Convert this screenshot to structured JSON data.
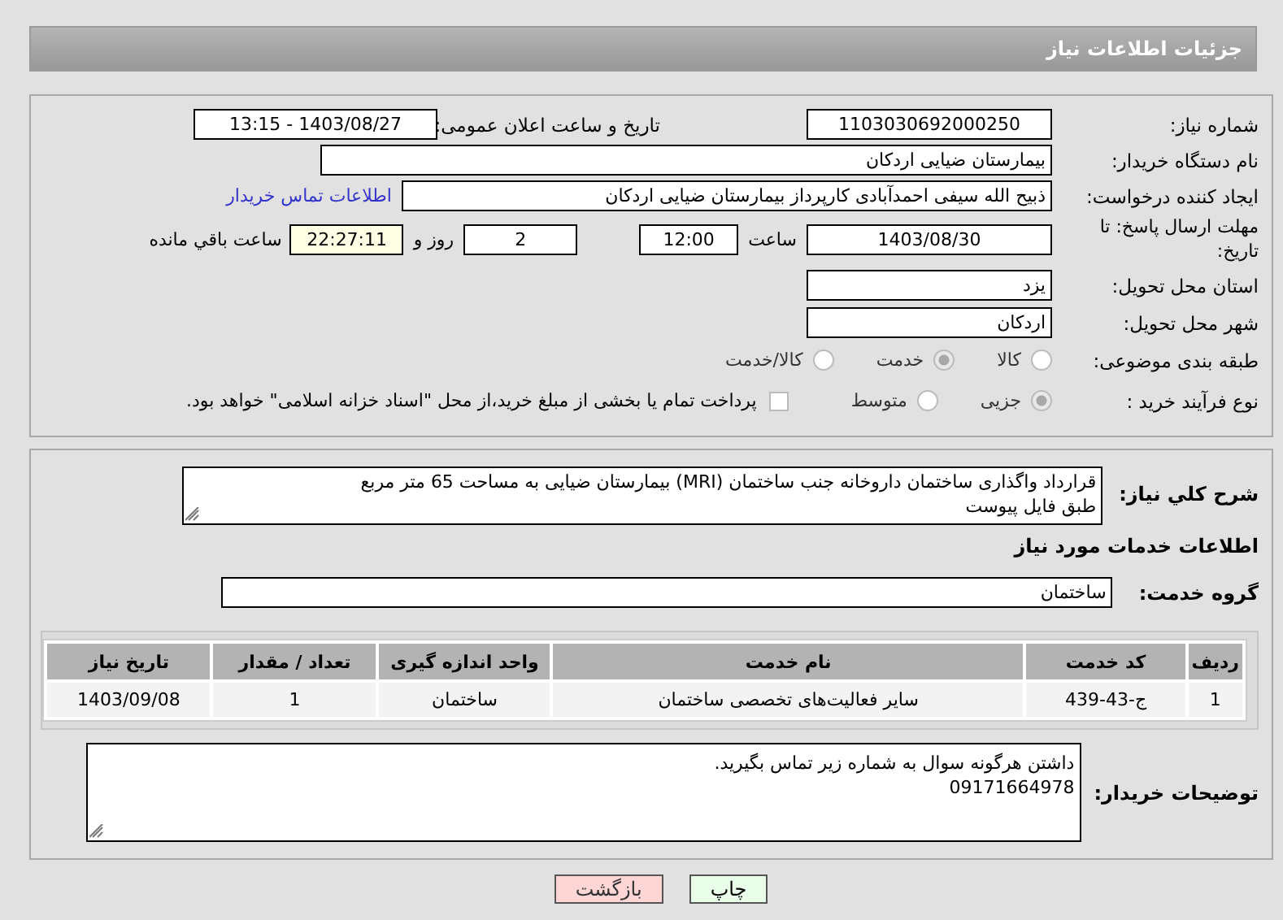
{
  "header": {
    "title": "جزئیات اطلاعات نیاز"
  },
  "details": {
    "need_number": {
      "label": "شماره نیاز:",
      "value": "1103030692000250"
    },
    "announce": {
      "label": "تاریخ و ساعت اعلان عمومی:",
      "value": "1403/08/27 - 13:15"
    },
    "buyer_org": {
      "label": "نام دستگاه خریدار:",
      "value": "بیمارستان ضیایی اردکان"
    },
    "requester": {
      "label": "ایجاد کننده درخواست:",
      "value": "ذبیح الله سیفی احمدآبادی کارپرداز بیمارستان ضیایی اردکان",
      "link": "اطلاعات تماس خریدار"
    },
    "deadline": {
      "label": "مهلت ارسال پاسخ: تا تاریخ:",
      "date": "1403/08/30",
      "time_label": "ساعت",
      "time": "12:00",
      "days": "2",
      "days_label": "روز و",
      "remaining": "22:27:11",
      "remaining_label": "ساعت باقي مانده"
    },
    "province": {
      "label": "استان محل تحویل:",
      "value": "یزد"
    },
    "city": {
      "label": "شهر محل تحویل:",
      "value": "اردکان"
    },
    "category": {
      "label": "طبقه بندی موضوعی:",
      "options": [
        {
          "label": "کالا",
          "selected": false
        },
        {
          "label": "خدمت",
          "selected": true
        },
        {
          "label": "کالا/خدمت",
          "selected": false
        }
      ]
    },
    "purchase_type": {
      "label": "نوع فرآیند خرید :",
      "options": [
        {
          "label": "جزیی",
          "selected": true
        },
        {
          "label": "متوسط",
          "selected": false
        }
      ],
      "payment": {
        "label": "پرداخت تمام یا بخشی از مبلغ خرید،از محل \"اسناد خزانه اسلامی\" خواهد بود.",
        "checked": false
      }
    }
  },
  "summary": {
    "label": "شرح کلي نیاز:",
    "lines": [
      "قرارداد واگذاری ساختمان داروخانه جنب ساختمان (MRI) بیمارستان ضیایی به مساحت 65 متر مربع",
      "طبق فایل پیوست"
    ]
  },
  "services_heading": "اطلاعات خدمات مورد نیاز",
  "service_group": {
    "label": "گروه خدمت:",
    "value": "ساختمان"
  },
  "table": {
    "columns": [
      "ردیف",
      "کد خدمت",
      "نام خدمت",
      "واحد اندازه گیری",
      "تعداد / مقدار",
      "تاریخ نیاز"
    ],
    "rows": [
      [
        "1",
        "ج-43-439",
        "سایر فعالیت‌های تخصصی ساختمان",
        "ساختمان",
        "1",
        "1403/09/08"
      ]
    ]
  },
  "buyer_notes": {
    "label": "توضیحات خریدار:",
    "lines": [
      "داشتن هرگونه سوال به شماره زیر تماس بگیرید.",
      "09171664978"
    ]
  },
  "buttons": [
    {
      "label": "چاپ",
      "kind": "print"
    },
    {
      "label": "بازگشت",
      "kind": "back"
    }
  ]
}
